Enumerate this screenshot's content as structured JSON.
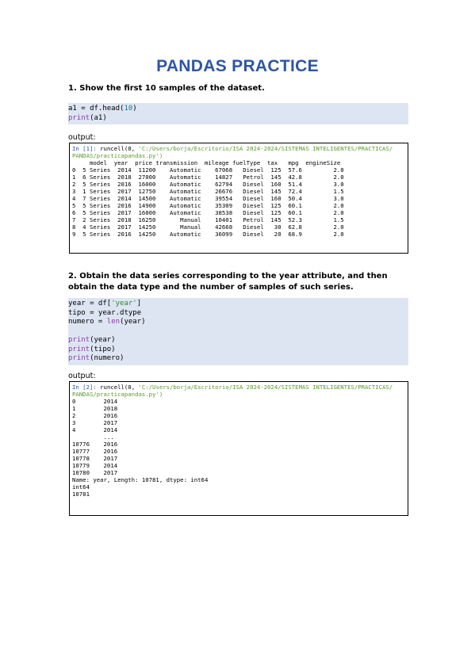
{
  "title": "PANDAS PRACTICE",
  "q1": {
    "text": "1. Show the first 10 samples of the dataset.",
    "code": [
      [
        {
          "t": "a1 = df.head(",
          "c": ""
        },
        {
          "t": "10",
          "c": "num"
        },
        {
          "t": ")",
          "c": ""
        }
      ],
      [
        {
          "t": "print",
          "c": "kw"
        },
        {
          "t": "(a1)",
          "c": ""
        }
      ]
    ],
    "output_label": "output:",
    "output": {
      "cmd_line1_prompt": "In [1]: ",
      "cmd_line1_fn": "runcell(0, ",
      "cmd_line1_path": "'C:/Users/borja/Escritorio/ISA 2024-2024/SISTEMAS INTELIGENTES/PRACTICAS/",
      "cmd_line2_path": "PANDAS/practicapandas.py')",
      "rows": [
        "     model  year  price transmission  mileage fuelType  tax   mpg  engineSize",
        "0  5 Series  2014  11200    Automatic    67068   Diesel  125  57.6         2.0",
        "1  6 Series  2018  27000    Automatic    14827   Petrol  145  42.8         2.0",
        "2  5 Series  2016  16000    Automatic    62794   Diesel  160  51.4         3.0",
        "3  1 Series  2017  12750    Automatic    26676   Diesel  145  72.4         1.5",
        "4  7 Series  2014  14500    Automatic    39554   Diesel  160  50.4         3.0",
        "5  5 Series  2016  14900    Automatic    35309   Diesel  125  60.1         2.0",
        "6  5 Series  2017  16000    Automatic    38538   Diesel  125  60.1         2.0",
        "7  2 Series  2018  16250       Manual    10401   Petrol  145  52.3         1.5",
        "8  4 Series  2017  14250       Manual    42668   Diesel   30  62.8         2.0",
        "9  5 Series  2016  14250    Automatic    36099   Diesel   20  68.9         2.0"
      ]
    }
  },
  "q2": {
    "text": "2. Obtain the data series corresponding to the year attribute, and then obtain the data type and the number of samples of such series.",
    "code": [
      [
        {
          "t": "year = df[",
          "c": ""
        },
        {
          "t": "'year'",
          "c": "str"
        },
        {
          "t": "]",
          "c": ""
        }
      ],
      [
        {
          "t": "tipo = year.dtype",
          "c": ""
        }
      ],
      [
        {
          "t": "numero = ",
          "c": ""
        },
        {
          "t": "len",
          "c": "kw"
        },
        {
          "t": "(year)",
          "c": ""
        }
      ],
      [
        {
          "t": "",
          "c": ""
        }
      ],
      [
        {
          "t": "print",
          "c": "kw"
        },
        {
          "t": "(year)",
          "c": ""
        }
      ],
      [
        {
          "t": "print",
          "c": "kw"
        },
        {
          "t": "(tipo)",
          "c": ""
        }
      ],
      [
        {
          "t": "print",
          "c": "kw"
        },
        {
          "t": "(numero)",
          "c": ""
        }
      ]
    ],
    "output_label": "output:",
    "output": {
      "cmd_line1_prompt": "In [2]: ",
      "cmd_line1_fn": "runcell(0, ",
      "cmd_line1_path": "'C:/Users/borja/Escritorio/ISA 2024-2024/SISTEMAS INTELIGENTES/PRACTICAS/",
      "cmd_line2_path": "PANDAS/practicapandas.py')",
      "rows": [
        "0        2014",
        "1        2018",
        "2        2016",
        "3        2017",
        "4        2014",
        "         ...",
        "10776    2016",
        "10777    2016",
        "10778    2017",
        "10779    2014",
        "10780    2017",
        "Name: year, Length: 10781, dtype: int64",
        "int64",
        "10781"
      ]
    }
  }
}
